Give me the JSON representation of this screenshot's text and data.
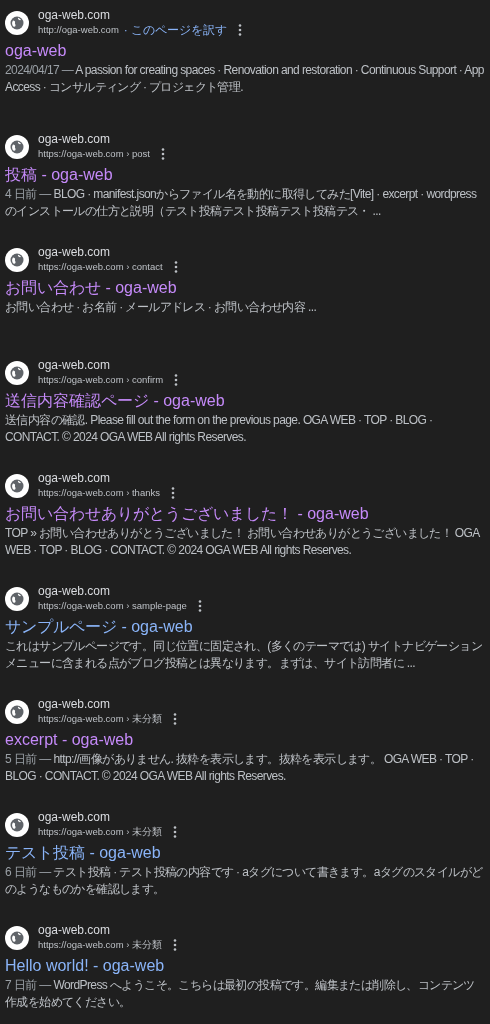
{
  "results": [
    {
      "site": "oga-web.com",
      "url": "http://oga-web.com",
      "translate": "· このページを訳す",
      "title": "oga-web",
      "visited": true,
      "date": "2024/04/17 —",
      "snippet": "A passion for creating spaces · Renovation and restoration · Continuous Support · App Access · コンサルティング · プロジェクト管理."
    },
    {
      "site": "oga-web.com",
      "url": "https://oga-web.com › post",
      "title": "投稿 - oga-web",
      "visited": true,
      "date": "4 日前 —",
      "snippet": "BLOG · manifest.jsonからファイル名を動的に取得してみた[Vite] · excerpt · wordpressのインストールの仕方と説明（テスト投稿テスト投稿テスト投稿テス・ ..."
    },
    {
      "site": "oga-web.com",
      "url": "https://oga-web.com › contact",
      "title": "お問い合わせ - oga-web",
      "visited": true,
      "snippet": "お問い合わせ · お名前 · メールアドレス · お問い合わせ内容 ..."
    },
    {
      "site": "oga-web.com",
      "url": "https://oga-web.com › confirm",
      "title": "送信内容確認ページ - oga-web",
      "visited": true,
      "snippet": "送信内容の確認. Please fill out the form on the previous page. OGA WEB · TOP · BLOG · CONTACT. © 2024 OGA WEB All rights Reserves."
    },
    {
      "site": "oga-web.com",
      "url": "https://oga-web.com › thanks",
      "title": "お問い合わせありがとうございました！ - oga-web",
      "visited": true,
      "snippet": "TOP » お問い合わせありがとうございました！ お問い合わせありがとうございました！ OGA WEB · TOP · BLOG · CONTACT. © 2024 OGA WEB All rights Reserves."
    },
    {
      "site": "oga-web.com",
      "url": "https://oga-web.com › sample-page",
      "title": "サンプルページ - oga-web",
      "visited": false,
      "snippet": "これはサンプルページです。同じ位置に固定され、(多くのテーマでは) サイトナビゲーションメニューに含まれる点がブログ投稿とは異なります。まずは、サイト訪問者に ..."
    },
    {
      "site": "oga-web.com",
      "url": "https://oga-web.com › 未分類",
      "title": "excerpt - oga-web",
      "visited": true,
      "date": "5 日前 —",
      "snippet": "http://画像がありません. 抜粋を表示します。抜粋を表示します。 OGA WEB · TOP · BLOG · CONTACT. © 2024 OGA WEB All rights Reserves."
    },
    {
      "site": "oga-web.com",
      "url": "https://oga-web.com › 未分類",
      "title": "テスト投稿 - oga-web",
      "visited": false,
      "date": "6 日前 —",
      "snippet": "テスト投稿 · テスト投稿の内容です · aタグについて書きます。aタグのスタイルがどのようなものかを確認します。"
    },
    {
      "site": "oga-web.com",
      "url": "https://oga-web.com › 未分類",
      "title": "Hello world! - oga-web",
      "visited": false,
      "date": "7 日前 —",
      "snippet": "WordPress へようこそ。こちらは最初の投稿です。編集または削除し、コンテンツ作成を始めてください。"
    }
  ]
}
